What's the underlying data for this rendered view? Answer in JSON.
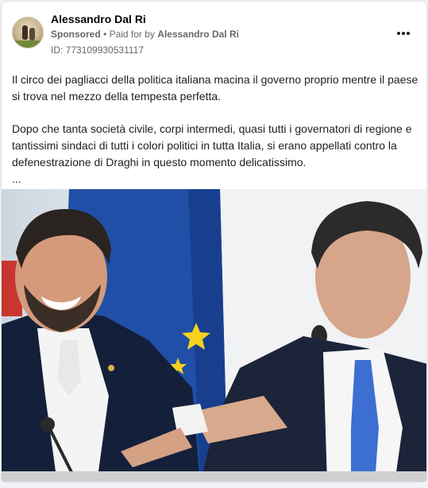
{
  "post": {
    "author_name": "Alessandro Dal Ri",
    "sponsored_label": "Sponsored",
    "separator": "•",
    "paid_for_prefix": "Paid for by",
    "payer_name": "Alessandro Dal Ri",
    "ad_id": "ID: 773109930531117",
    "paragraph_1": "Il circo dei pagliacci della politica italiana macina il governo proprio mentre il paese si trova nel mezzo della tempesta perfetta.",
    "paragraph_2": "Dopo che tanta società civile, corpi intermedi, quasi tutti i governatori di regione e tantissimi sindaci di tutti i colori politici in tutta Italia, si erano appellati contro la defenestrazione di Draghi in questo momento delicatissimo.",
    "see_more": "..."
  },
  "icons": {
    "avatar": "profile-photo",
    "more": "more-options-icon",
    "flag": "eu-flag"
  },
  "colors": {
    "card_background": "#ffffff",
    "page_background": "#f0f2f5",
    "secondary_text": "#65676b",
    "primary_text": "#1c1e21"
  }
}
